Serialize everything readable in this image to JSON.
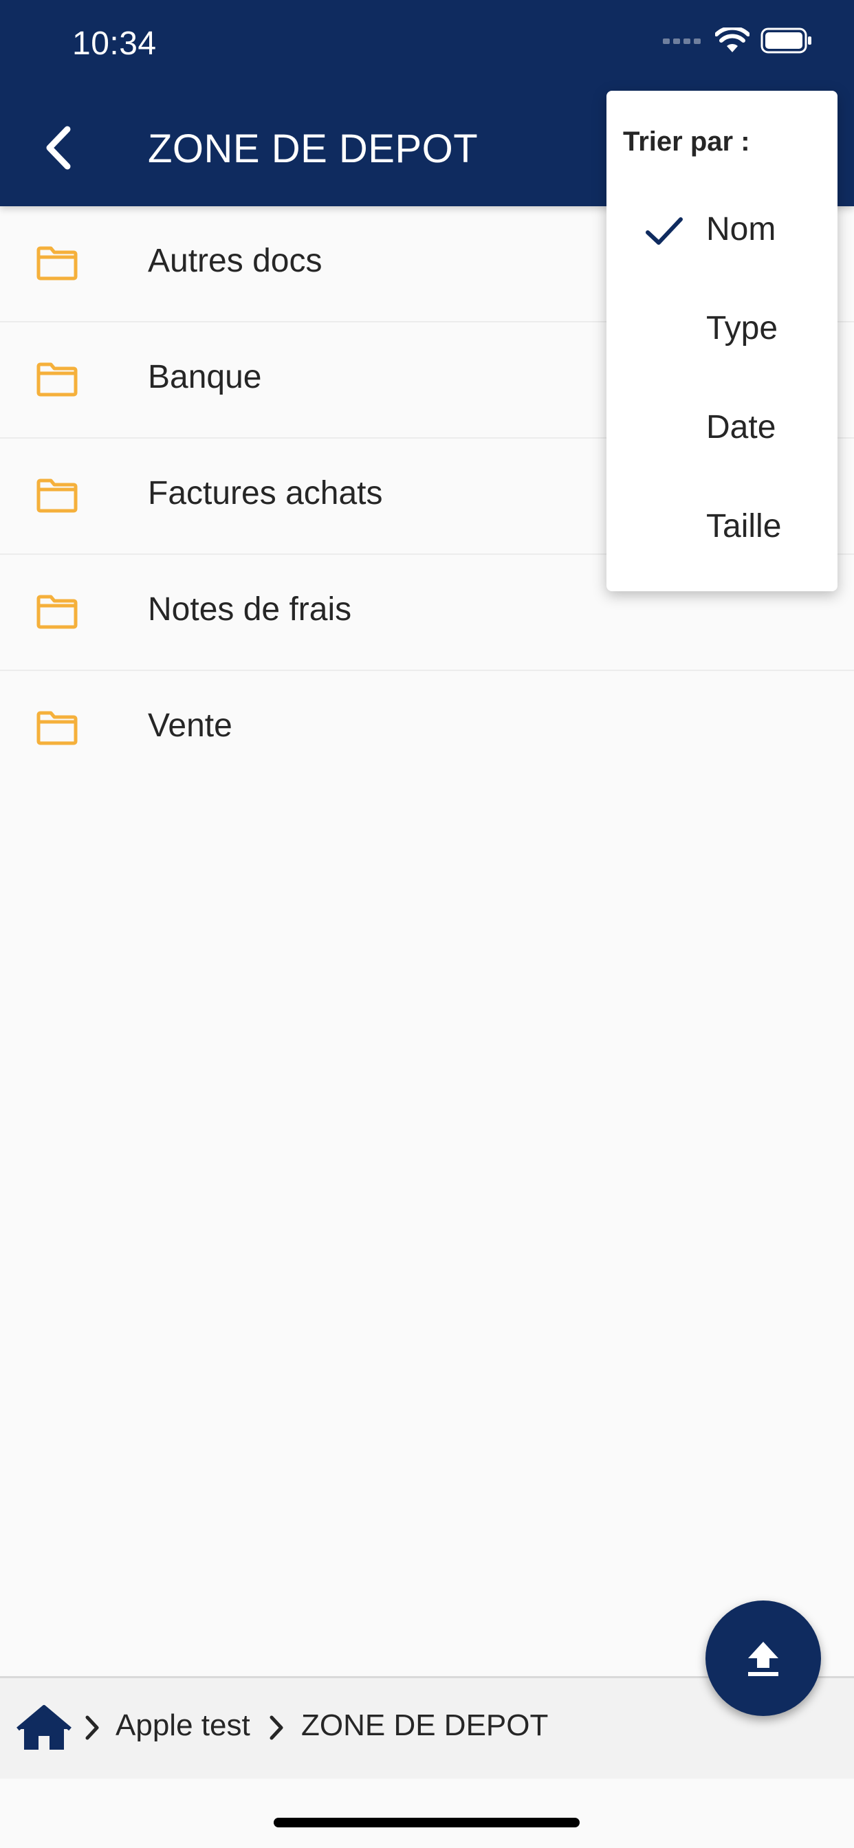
{
  "status_bar": {
    "time": "10:34"
  },
  "header": {
    "title": "ZONE DE DEPOT"
  },
  "folders": [
    {
      "label": "Autres docs"
    },
    {
      "label": "Banque"
    },
    {
      "label": "Factures achats"
    },
    {
      "label": "Notes de frais"
    },
    {
      "label": "Vente"
    }
  ],
  "sort_menu": {
    "title": "Trier par :",
    "options": [
      {
        "label": "Nom",
        "selected": true
      },
      {
        "label": "Type",
        "selected": false
      },
      {
        "label": "Date",
        "selected": false
      },
      {
        "label": "Taille",
        "selected": false
      }
    ]
  },
  "breadcrumb": {
    "items": [
      "Apple test",
      "ZONE DE DEPOT"
    ]
  },
  "colors": {
    "primary": "#0f2b5f",
    "folder": "#f5b03b",
    "background": "#fafafa"
  },
  "icons": {
    "back": "chevron-left-icon",
    "folder": "folder-icon",
    "check": "check-icon",
    "upload": "upload-icon",
    "home": "home-icon"
  }
}
